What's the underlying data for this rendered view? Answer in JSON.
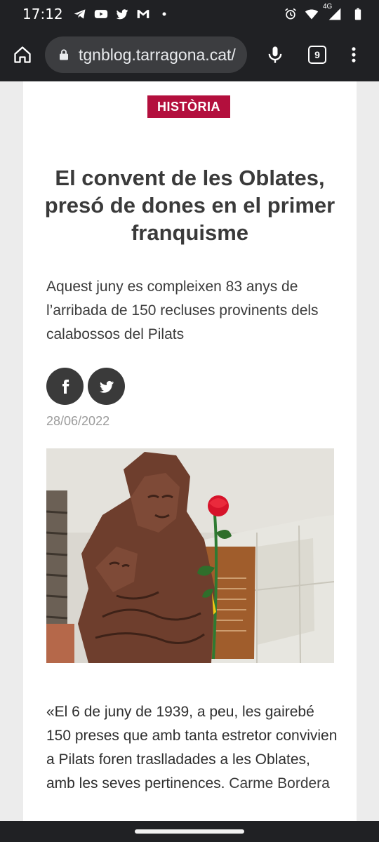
{
  "status_bar": {
    "time": "17:12",
    "network": "4G",
    "left_icons": [
      "telegram-icon",
      "youtube-icon",
      "twitter-icon",
      "gmail-icon",
      "dot-icon"
    ],
    "right_icons": [
      "alarm-icon",
      "wifi-icon",
      "signal-icon",
      "battery-icon"
    ]
  },
  "browser": {
    "url": "tgnblog.tarragona.cat/",
    "tab_count": "9"
  },
  "article": {
    "category": "HISTÒRIA",
    "title": "El convent de les Oblates, presó de dones en el primer franquisme",
    "lead": "Aquest juny es compleixen 83 anys de l’arribada de 150 recluses provinents dels calabossos del Pilats",
    "date": "28/06/2022",
    "body_bold": "«El 6 de juny de 1939, a peu, les gairebé 150 preses que amb tanta estretor convivien a Pilats foren traslladades a les Oblates, amb les seves pertinences.",
    "body_author": " Carme Bordera"
  },
  "colors": {
    "accent": "#b30f3d",
    "chrome": "#202124",
    "share_bg": "#3a3a3a"
  }
}
